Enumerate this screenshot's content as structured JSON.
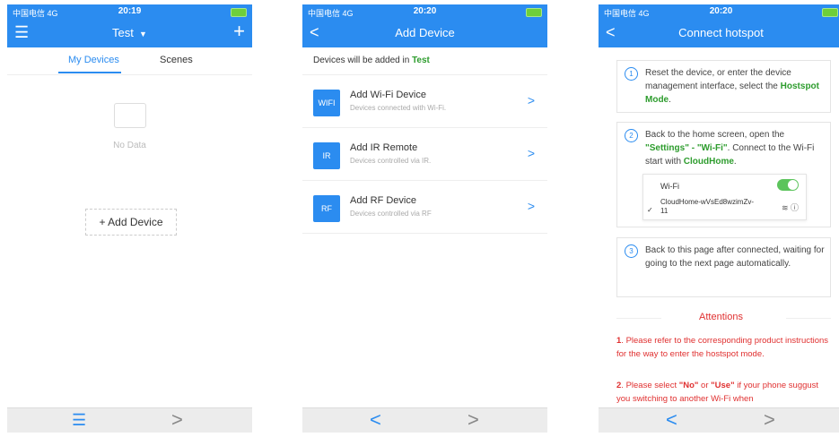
{
  "status": {
    "carrier": "中国电信  4G",
    "time_1": "20:19",
    "time_2": "20:20",
    "time_3": "20:20"
  },
  "panel1": {
    "title": "Test",
    "tabs": [
      "My Devices",
      "Scenes"
    ],
    "empty_text": "No Data",
    "add_device": "+ Add Device"
  },
  "panel2": {
    "title": "Add Device",
    "info_prefix": "Devices will be added in",
    "info_target": "Test",
    "devices": [
      {
        "badge": "WIFI",
        "title": "Add Wi-Fi Device",
        "subtitle": "Devices connected with Wi-Fi."
      },
      {
        "badge": "IR",
        "title": "Add IR Remote",
        "subtitle": "Devices controlled via IR."
      },
      {
        "badge": "RF",
        "title": "Add RF Device",
        "subtitle": "Devices controlled via RF"
      }
    ]
  },
  "panel3": {
    "title": "Connect hotspot",
    "steps": [
      {
        "num": "1",
        "text_a": "Reset the device, or enter the device management interface, select the",
        "text_b": "Hostspot Mode",
        "text_c": "."
      },
      {
        "num": "2",
        "text_a": "Back to the home screen, open the",
        "text_b": "\"Settings\" - \"Wi-Fi\"",
        "text_c": ". Connect to the Wi-Fi start with",
        "text_d": "CloudHome",
        "text_e": "."
      },
      {
        "num": "3",
        "text_a": "Back to this page after connected, waiting for going to the next page automatically."
      }
    ],
    "wifi_label": "Wi-Fi",
    "wifi_ssid": "CloudHome-wVsEd8wzimZv-11",
    "attentions_title": "Attentions",
    "att1_num": "1",
    "att1_text": ". Please refer to the corresponding product instructions for the way to enter the hostspot mode.",
    "att2_num": "2",
    "att2_a": ". Please select",
    "att2_no": "\"No\"",
    "att2_or": "or",
    "att2_use": "\"Use\"",
    "att2_b": "if your phone suggust you switching to another Wi-Fi when"
  },
  "colors": {
    "primary": "#2b8cf0",
    "green": "#2d9c2d",
    "red": "#e03030"
  }
}
